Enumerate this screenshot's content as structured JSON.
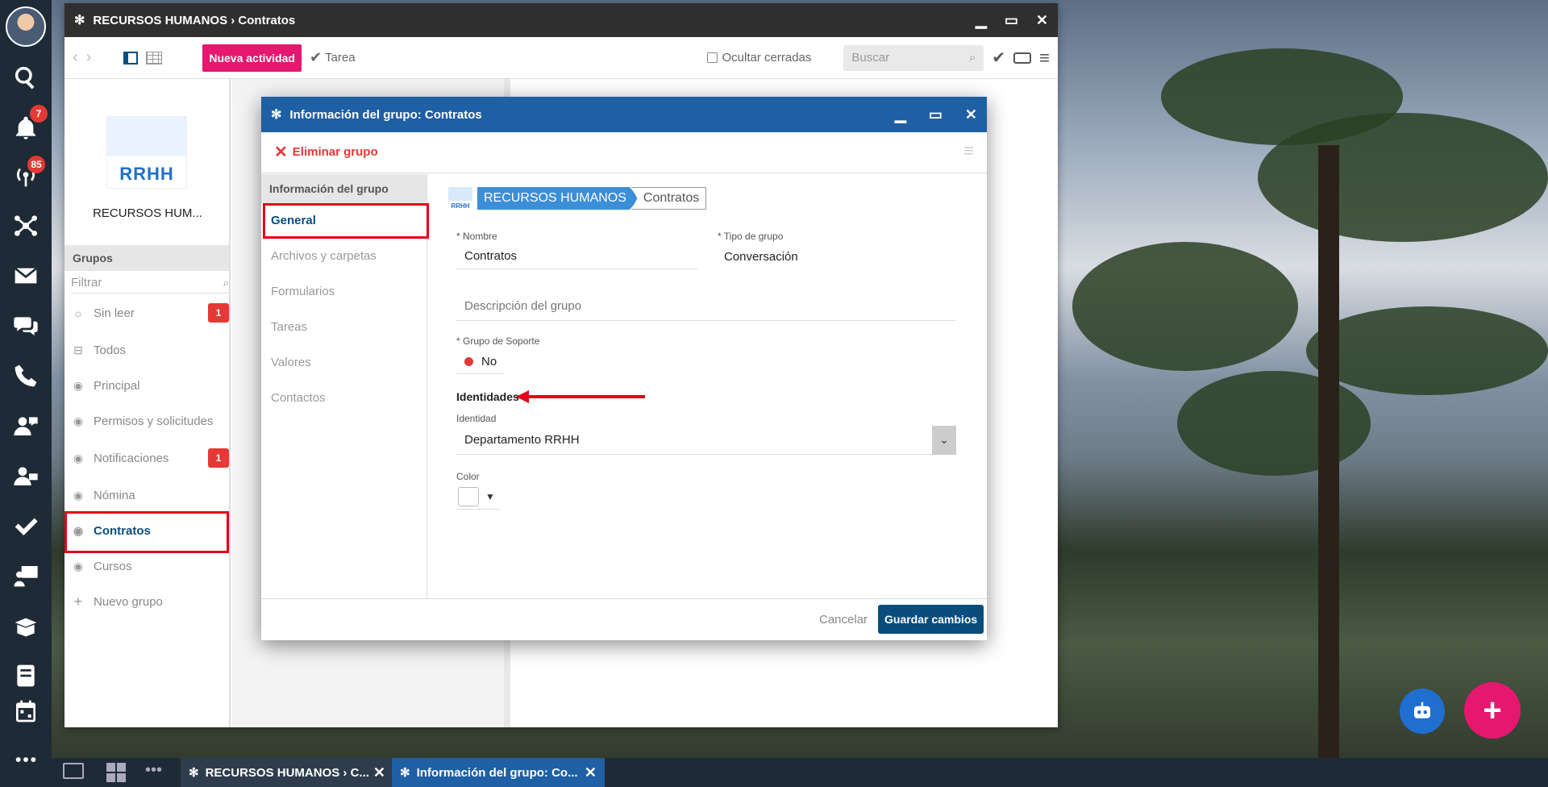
{
  "dock": {
    "badges": {
      "notifications": "7",
      "broadcast": "85"
    }
  },
  "main_window": {
    "title": "RECURSOS HUMANOS › Contratos",
    "toolbar": {
      "new_activity": "Nueva actividad",
      "task": "Tarea",
      "hide_closed": "Ocultar cerradas",
      "search_placeholder": "Buscar"
    },
    "sidebar": {
      "org_name": "RECURSOS HUM...",
      "logo_text": "RRHH",
      "groups_header": "Grupos",
      "filter_placeholder": "Filtrar",
      "items": [
        {
          "label": "Sin leer",
          "count": "1"
        },
        {
          "label": "Todos"
        },
        {
          "label": "Principal"
        },
        {
          "label": "Permisos y solicitudes"
        },
        {
          "label": "Notificaciones",
          "count": "1"
        },
        {
          "label": "Nómina"
        },
        {
          "label": "Contratos"
        },
        {
          "label": "Cursos"
        },
        {
          "label": "Nuevo grupo"
        }
      ]
    }
  },
  "dialog": {
    "title": "Información del grupo: Contratos",
    "delete_group": "Eliminar grupo",
    "nav_header": "Información del grupo",
    "nav_items": [
      "General",
      "Archivos y carpetas",
      "Formularios",
      "Tareas",
      "Valores",
      "Contactos"
    ],
    "breadcrumb": {
      "logo_text": "RRHH",
      "parent": "RECURSOS HUMANOS",
      "current": "Contratos"
    },
    "fields": {
      "name_label": "Nombre",
      "name_value": "Contratos",
      "type_label": "Tipo de grupo",
      "type_value": "Conversación",
      "description_placeholder": "Descripción del grupo",
      "support_label": "Grupo de Soporte",
      "support_value": "No",
      "identities_header": "Identidades",
      "identity_label": "Identidad",
      "identity_value": "Departamento RRHH",
      "color_label": "Color"
    },
    "cancel": "Cancelar",
    "save": "Guardar cambios"
  },
  "taskbar": {
    "tabs": [
      "RECURSOS HUMANOS › C...",
      "Información del grupo: Co..."
    ]
  }
}
